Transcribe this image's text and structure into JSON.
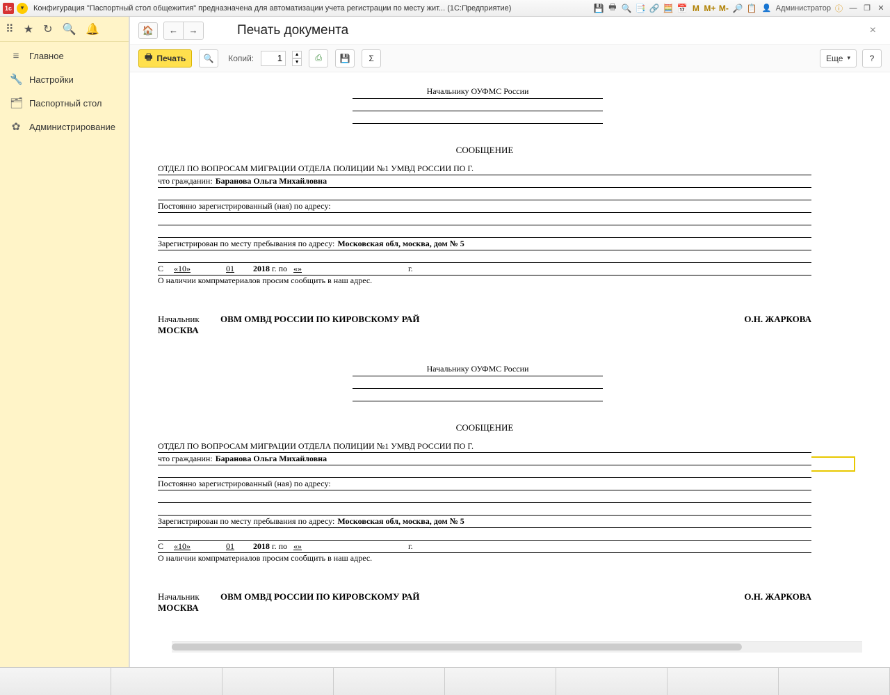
{
  "titlebar": {
    "text": "Конфигурация \"Паспортный стол общежития\" предназначена для автоматизации учета регистрации по месту жит...  (1С:Предприятие)",
    "user": "Администратор",
    "m_labels": [
      "M",
      "M+",
      "M-"
    ]
  },
  "sidebar": {
    "items": [
      {
        "icon": "≡",
        "label": "Главное"
      },
      {
        "icon": "🔧",
        "label": "Настройки"
      },
      {
        "icon": "🗂",
        "label": "Паспортный стол"
      },
      {
        "icon": "✿",
        "label": "Администрирование"
      }
    ]
  },
  "page": {
    "title": "Печать документа"
  },
  "toolbar": {
    "print": "Печать",
    "copies_label": "Копий:",
    "copies_value": "1",
    "more": "Еще",
    "help": "?"
  },
  "doc": {
    "recipient": "Начальнику ОУФМС России",
    "heading": "СООБЩЕНИЕ",
    "dept": "ОТДЕЛ ПО ВОПРОСАМ МИГРАЦИИ ОТДЕЛА ПОЛИЦИИ №1 УМВД РОССИИ ПО Г.",
    "citizen_label": "что гражданин:",
    "citizen_name": "Баранова Ольга Михайловна",
    "perm_reg_label": "Постоянно зарегистрированный (ная) по адресу:",
    "temp_reg_label": "Зарегистрирован по месту пребывания по адресу:",
    "temp_reg_addr": "Московская обл, москва, дом № 5",
    "date_from_c": "С",
    "date_from_day": "«10»",
    "date_from_month": "01",
    "date_from_year": "2018",
    "date_to": "г. по",
    "date_to_day": "«»",
    "date_to_year": "г.",
    "materials_note": "О наличии компрматериалов просим сообщить в наш адрес.",
    "chief_label": "Начальник",
    "chief_dept": "ОВМ ОМВД РОССИИ ПО КИРОВСКОМУ РАЙ",
    "chief_city": "МОСКВА",
    "chief_name": "О.Н. ЖАРКОВА"
  }
}
